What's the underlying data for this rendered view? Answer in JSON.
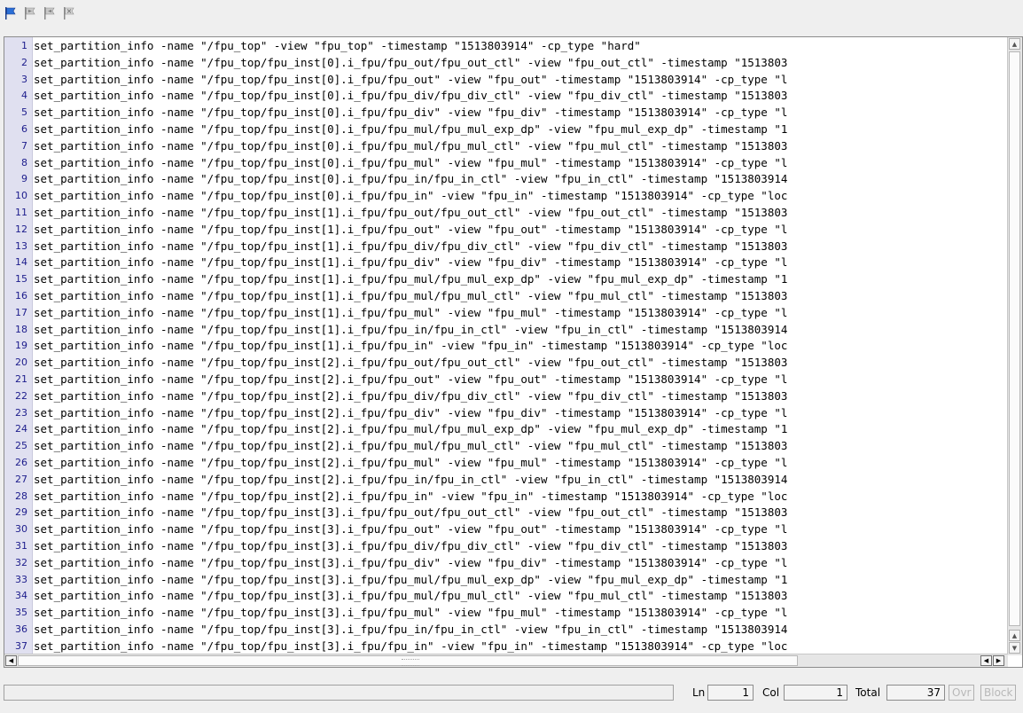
{
  "toolbar": {
    "icons": [
      "flag-icon",
      "flag-next-icon",
      "flag-prev-icon",
      "flag-clear-icon"
    ],
    "accent": "#1a5fb4"
  },
  "editor": {
    "lines": [
      {
        "n": "1",
        "text": "set_partition_info -name \"/fpu_top\" -view \"fpu_top\" -timestamp \"1513803914\" -cp_type \"hard\""
      },
      {
        "n": "2",
        "text": "set_partition_info -name \"/fpu_top/fpu_inst[0].i_fpu/fpu_out/fpu_out_ctl\" -view \"fpu_out_ctl\" -timestamp \"1513803"
      },
      {
        "n": "3",
        "text": "set_partition_info -name \"/fpu_top/fpu_inst[0].i_fpu/fpu_out\" -view \"fpu_out\" -timestamp \"1513803914\" -cp_type \"l"
      },
      {
        "n": "4",
        "text": "set_partition_info -name \"/fpu_top/fpu_inst[0].i_fpu/fpu_div/fpu_div_ctl\" -view \"fpu_div_ctl\" -timestamp \"1513803"
      },
      {
        "n": "5",
        "text": "set_partition_info -name \"/fpu_top/fpu_inst[0].i_fpu/fpu_div\" -view \"fpu_div\" -timestamp \"1513803914\" -cp_type \"l"
      },
      {
        "n": "6",
        "text": "set_partition_info -name \"/fpu_top/fpu_inst[0].i_fpu/fpu_mul/fpu_mul_exp_dp\" -view \"fpu_mul_exp_dp\" -timestamp \"1"
      },
      {
        "n": "7",
        "text": "set_partition_info -name \"/fpu_top/fpu_inst[0].i_fpu/fpu_mul/fpu_mul_ctl\" -view \"fpu_mul_ctl\" -timestamp \"1513803"
      },
      {
        "n": "8",
        "text": "set_partition_info -name \"/fpu_top/fpu_inst[0].i_fpu/fpu_mul\" -view \"fpu_mul\" -timestamp \"1513803914\" -cp_type \"l"
      },
      {
        "n": "9",
        "text": "set_partition_info -name \"/fpu_top/fpu_inst[0].i_fpu/fpu_in/fpu_in_ctl\" -view \"fpu_in_ctl\" -timestamp \"1513803914"
      },
      {
        "n": "10",
        "text": "set_partition_info -name \"/fpu_top/fpu_inst[0].i_fpu/fpu_in\" -view \"fpu_in\" -timestamp \"1513803914\" -cp_type \"loc"
      },
      {
        "n": "11",
        "text": "set_partition_info -name \"/fpu_top/fpu_inst[1].i_fpu/fpu_out/fpu_out_ctl\" -view \"fpu_out_ctl\" -timestamp \"1513803"
      },
      {
        "n": "12",
        "text": "set_partition_info -name \"/fpu_top/fpu_inst[1].i_fpu/fpu_out\" -view \"fpu_out\" -timestamp \"1513803914\" -cp_type \"l"
      },
      {
        "n": "13",
        "text": "set_partition_info -name \"/fpu_top/fpu_inst[1].i_fpu/fpu_div/fpu_div_ctl\" -view \"fpu_div_ctl\" -timestamp \"1513803"
      },
      {
        "n": "14",
        "text": "set_partition_info -name \"/fpu_top/fpu_inst[1].i_fpu/fpu_div\" -view \"fpu_div\" -timestamp \"1513803914\" -cp_type \"l"
      },
      {
        "n": "15",
        "text": "set_partition_info -name \"/fpu_top/fpu_inst[1].i_fpu/fpu_mul/fpu_mul_exp_dp\" -view \"fpu_mul_exp_dp\" -timestamp \"1"
      },
      {
        "n": "16",
        "text": "set_partition_info -name \"/fpu_top/fpu_inst[1].i_fpu/fpu_mul/fpu_mul_ctl\" -view \"fpu_mul_ctl\" -timestamp \"1513803"
      },
      {
        "n": "17",
        "text": "set_partition_info -name \"/fpu_top/fpu_inst[1].i_fpu/fpu_mul\" -view \"fpu_mul\" -timestamp \"1513803914\" -cp_type \"l"
      },
      {
        "n": "18",
        "text": "set_partition_info -name \"/fpu_top/fpu_inst[1].i_fpu/fpu_in/fpu_in_ctl\" -view \"fpu_in_ctl\" -timestamp \"1513803914"
      },
      {
        "n": "19",
        "text": "set_partition_info -name \"/fpu_top/fpu_inst[1].i_fpu/fpu_in\" -view \"fpu_in\" -timestamp \"1513803914\" -cp_type \"loc"
      },
      {
        "n": "20",
        "text": "set_partition_info -name \"/fpu_top/fpu_inst[2].i_fpu/fpu_out/fpu_out_ctl\" -view \"fpu_out_ctl\" -timestamp \"1513803"
      },
      {
        "n": "21",
        "text": "set_partition_info -name \"/fpu_top/fpu_inst[2].i_fpu/fpu_out\" -view \"fpu_out\" -timestamp \"1513803914\" -cp_type \"l"
      },
      {
        "n": "22",
        "text": "set_partition_info -name \"/fpu_top/fpu_inst[2].i_fpu/fpu_div/fpu_div_ctl\" -view \"fpu_div_ctl\" -timestamp \"1513803"
      },
      {
        "n": "23",
        "text": "set_partition_info -name \"/fpu_top/fpu_inst[2].i_fpu/fpu_div\" -view \"fpu_div\" -timestamp \"1513803914\" -cp_type \"l"
      },
      {
        "n": "24",
        "text": "set_partition_info -name \"/fpu_top/fpu_inst[2].i_fpu/fpu_mul/fpu_mul_exp_dp\" -view \"fpu_mul_exp_dp\" -timestamp \"1"
      },
      {
        "n": "25",
        "text": "set_partition_info -name \"/fpu_top/fpu_inst[2].i_fpu/fpu_mul/fpu_mul_ctl\" -view \"fpu_mul_ctl\" -timestamp \"1513803"
      },
      {
        "n": "26",
        "text": "set_partition_info -name \"/fpu_top/fpu_inst[2].i_fpu/fpu_mul\" -view \"fpu_mul\" -timestamp \"1513803914\" -cp_type \"l"
      },
      {
        "n": "27",
        "text": "set_partition_info -name \"/fpu_top/fpu_inst[2].i_fpu/fpu_in/fpu_in_ctl\" -view \"fpu_in_ctl\" -timestamp \"1513803914"
      },
      {
        "n": "28",
        "text": "set_partition_info -name \"/fpu_top/fpu_inst[2].i_fpu/fpu_in\" -view \"fpu_in\" -timestamp \"1513803914\" -cp_type \"loc"
      },
      {
        "n": "29",
        "text": "set_partition_info -name \"/fpu_top/fpu_inst[3].i_fpu/fpu_out/fpu_out_ctl\" -view \"fpu_out_ctl\" -timestamp \"1513803"
      },
      {
        "n": "30",
        "text": "set_partition_info -name \"/fpu_top/fpu_inst[3].i_fpu/fpu_out\" -view \"fpu_out\" -timestamp \"1513803914\" -cp_type \"l"
      },
      {
        "n": "31",
        "text": "set_partition_info -name \"/fpu_top/fpu_inst[3].i_fpu/fpu_div/fpu_div_ctl\" -view \"fpu_div_ctl\" -timestamp \"1513803"
      },
      {
        "n": "32",
        "text": "set_partition_info -name \"/fpu_top/fpu_inst[3].i_fpu/fpu_div\" -view \"fpu_div\" -timestamp \"1513803914\" -cp_type \"l"
      },
      {
        "n": "33",
        "text": "set_partition_info -name \"/fpu_top/fpu_inst[3].i_fpu/fpu_mul/fpu_mul_exp_dp\" -view \"fpu_mul_exp_dp\" -timestamp \"1"
      },
      {
        "n": "34",
        "text": "set_partition_info -name \"/fpu_top/fpu_inst[3].i_fpu/fpu_mul/fpu_mul_ctl\" -view \"fpu_mul_ctl\" -timestamp \"1513803"
      },
      {
        "n": "35",
        "text": "set_partition_info -name \"/fpu_top/fpu_inst[3].i_fpu/fpu_mul\" -view \"fpu_mul\" -timestamp \"1513803914\" -cp_type \"l"
      },
      {
        "n": "36",
        "text": "set_partition_info -name \"/fpu_top/fpu_inst[3].i_fpu/fpu_in/fpu_in_ctl\" -view \"fpu_in_ctl\" -timestamp \"1513803914"
      },
      {
        "n": "37",
        "text": "set_partition_info -name \"/fpu_top/fpu_inst[3].i_fpu/fpu_in\" -view \"fpu_in\" -timestamp \"1513803914\" -cp_type \"loc"
      }
    ]
  },
  "status": {
    "message": "",
    "ln_label": "Ln",
    "ln_value": "1",
    "col_label": "Col",
    "col_value": "1",
    "total_label": "Total",
    "total_value": "37",
    "ovr_label": "Ovr",
    "block_label": "Block"
  }
}
